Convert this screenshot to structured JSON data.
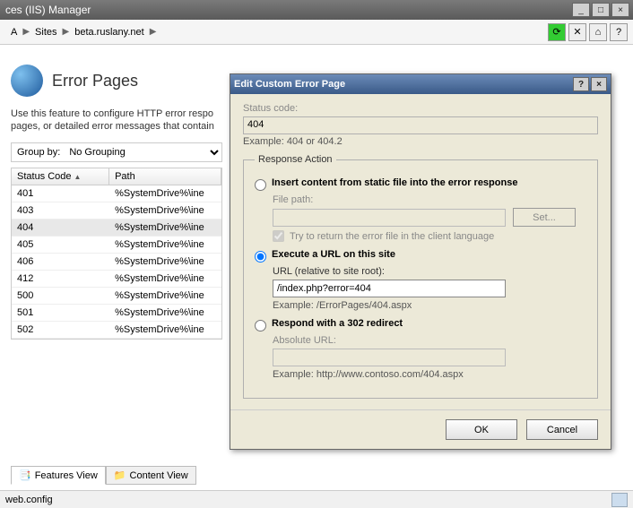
{
  "window": {
    "title": "ces (IIS) Manager"
  },
  "breadcrumb": {
    "items": [
      "A",
      "Sites",
      "beta.ruslany.net"
    ]
  },
  "page": {
    "title": "Error Pages",
    "description": "Use this feature to configure HTTP error respo pages, or detailed error messages that contain"
  },
  "groupby": {
    "label": "Group by:",
    "value": "No Grouping"
  },
  "grid": {
    "headers": [
      "Status Code",
      "Path"
    ],
    "rows": [
      {
        "code": "401",
        "path": "%SystemDrive%\\ine"
      },
      {
        "code": "403",
        "path": "%SystemDrive%\\ine"
      },
      {
        "code": "404",
        "path": "%SystemDrive%\\ine",
        "selected": true
      },
      {
        "code": "405",
        "path": "%SystemDrive%\\ine"
      },
      {
        "code": "406",
        "path": "%SystemDrive%\\ine"
      },
      {
        "code": "412",
        "path": "%SystemDrive%\\ine"
      },
      {
        "code": "500",
        "path": "%SystemDrive%\\ine"
      },
      {
        "code": "501",
        "path": "%SystemDrive%\\ine"
      },
      {
        "code": "502",
        "path": "%SystemDrive%\\ine"
      }
    ]
  },
  "tabs": {
    "features": "Features View",
    "content": "Content View"
  },
  "statusbar": {
    "text": "web.config"
  },
  "dialog": {
    "title": "Edit Custom Error Page",
    "status_code_label": "Status code:",
    "status_code_value": "404",
    "status_code_example": "Example: 404 or 404.2",
    "group_label": "Response Action",
    "opt1": {
      "label": "Insert content from static file into the error response",
      "filepath_label": "File path:",
      "set_button": "Set...",
      "checkbox_label": "Try to return the error file in the client language"
    },
    "opt2": {
      "label": "Execute a URL on this site",
      "url_label": "URL (relative to site root):",
      "url_value": "/index.php?error=404",
      "example": "Example: /ErrorPages/404.aspx"
    },
    "opt3": {
      "label": "Respond with a 302 redirect",
      "abs_label": "Absolute URL:",
      "example": "Example: http://www.contoso.com/404.aspx"
    },
    "ok_label": "OK",
    "cancel_label": "Cancel"
  }
}
